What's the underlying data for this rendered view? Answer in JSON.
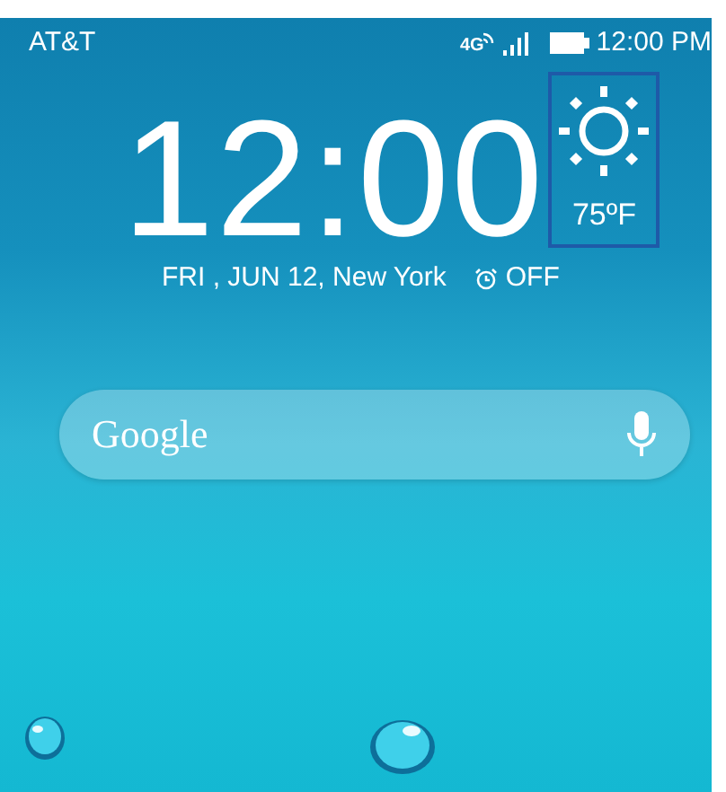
{
  "status_bar": {
    "carrier": "AT&T",
    "network": "4G",
    "time": "12:00 PM"
  },
  "clock": {
    "time": "12:00",
    "date": "FRI , JUN 12, New York",
    "alarm": "OFF"
  },
  "weather": {
    "temperature": "75ºF"
  },
  "search_bar": {
    "logo": "Google"
  }
}
